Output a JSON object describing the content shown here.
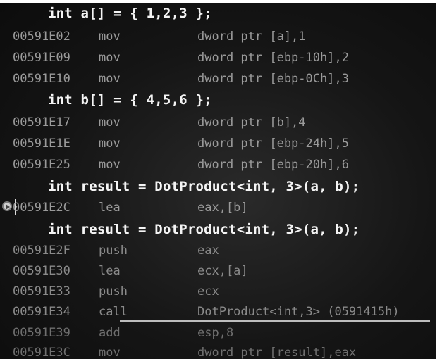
{
  "lines": [
    {
      "kind": "src",
      "text": "int a[] = { 1,2,3 };"
    },
    {
      "kind": "asm",
      "addr": "00591E02",
      "op": "mov",
      "args": "dword ptr [a],1"
    },
    {
      "kind": "asm",
      "addr": "00591E09",
      "op": "mov",
      "args": "dword ptr [ebp-10h],2"
    },
    {
      "kind": "asm",
      "addr": "00591E10",
      "op": "mov",
      "args": "dword ptr [ebp-0Ch],3"
    },
    {
      "kind": "src",
      "text": "int b[] = { 4,5,6 };"
    },
    {
      "kind": "asm",
      "addr": "00591E17",
      "op": "mov",
      "args": "dword ptr [b],4"
    },
    {
      "kind": "asm",
      "addr": "00591E1E",
      "op": "mov",
      "args": "dword ptr [ebp-24h],5"
    },
    {
      "kind": "asm",
      "addr": "00591E25",
      "op": "mov",
      "args": "dword ptr [ebp-20h],6"
    },
    {
      "kind": "src",
      "text": "int result = DotProduct<int, 3>(a, b);"
    },
    {
      "kind": "asm",
      "addr": "00591E2C",
      "op": "lea",
      "args": "eax,[b]"
    },
    {
      "kind": "src",
      "text": "int result = DotProduct<int, 3>(a, b);"
    },
    {
      "kind": "asm",
      "addr": "00591E2F",
      "op": "push",
      "args": "eax"
    },
    {
      "kind": "asm",
      "addr": "00591E30",
      "op": "lea",
      "args": "ecx,[a]"
    },
    {
      "kind": "asm",
      "addr": "00591E33",
      "op": "push",
      "args": "ecx"
    },
    {
      "kind": "asm",
      "addr": "00591E34",
      "op": "call",
      "args": "DotProduct<int,3> (0591415h)"
    },
    {
      "kind": "asm",
      "addr": "00591E39",
      "op": "add",
      "args": "esp,8"
    },
    {
      "kind": "asm",
      "addr": "00591E3C",
      "op": "mov",
      "args": "dword ptr [result],eax"
    }
  ]
}
